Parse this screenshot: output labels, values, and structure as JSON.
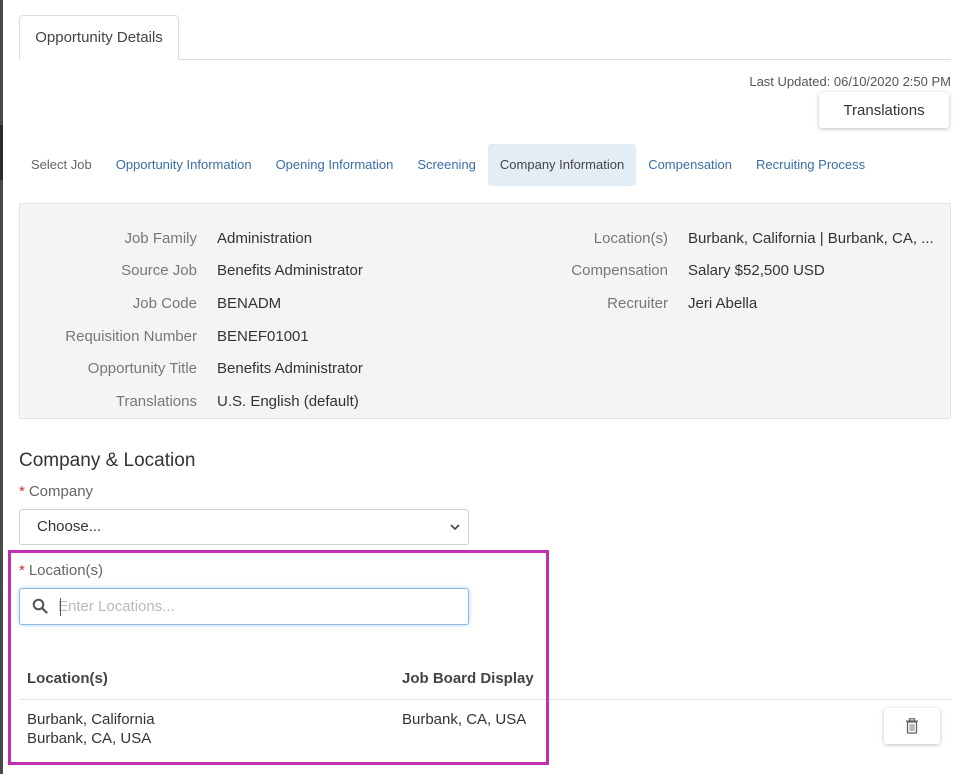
{
  "header": {
    "tab_label": "Opportunity Details",
    "last_updated": "Last Updated: 06/10/2020 2:50 PM",
    "translations_button": "Translations"
  },
  "steps": [
    {
      "label": "Select Job",
      "state": "plain"
    },
    {
      "label": "Opportunity Information",
      "state": "link"
    },
    {
      "label": "Opening Information",
      "state": "link"
    },
    {
      "label": "Screening",
      "state": "link"
    },
    {
      "label": "Company Information",
      "state": "active"
    },
    {
      "label": "Compensation",
      "state": "link"
    },
    {
      "label": "Recruiting Process",
      "state": "link"
    }
  ],
  "summary": {
    "left": [
      {
        "label": "Job Family",
        "value": "Administration"
      },
      {
        "label": "Source Job",
        "value": "Benefits Administrator"
      },
      {
        "label": "Job Code",
        "value": "BENADM"
      },
      {
        "label": "Requisition Number",
        "value": "BENEF01001"
      },
      {
        "label": "Opportunity Title",
        "value": "Benefits Administrator"
      },
      {
        "label": "Translations",
        "value": "U.S. English (default)"
      }
    ],
    "right": [
      {
        "label": "Location(s)",
        "value": "Burbank, California | Burbank, CA, ..."
      },
      {
        "label": "Compensation",
        "value": "Salary $52,500 USD"
      },
      {
        "label": "Recruiter",
        "value": "Jeri Abella"
      }
    ]
  },
  "company_location": {
    "title": "Company & Location",
    "required_marker": "*",
    "company_label": "Company",
    "company_selected": "Choose...",
    "locations_label": "Location(s)",
    "locations_placeholder": "Enter Locations...",
    "locations_value": "",
    "table": {
      "headers": [
        "Location(s)",
        "Job Board Display"
      ],
      "rows": [
        {
          "location_line1": "Burbank, California",
          "location_line2": "Burbank, CA, USA",
          "job_board_display": "Burbank, CA, USA"
        }
      ]
    }
  },
  "icons": {
    "select_chevron": "chevron-down-icon",
    "search": "search-icon",
    "delete": "trash-icon"
  },
  "colors": {
    "link": "#3a6ea8",
    "active_step_bg": "#e3edf6",
    "summary_bg": "#f4f4f4",
    "required": "#d0312d",
    "highlight": "#c02fb2",
    "focus_border": "#8db9e6"
  }
}
